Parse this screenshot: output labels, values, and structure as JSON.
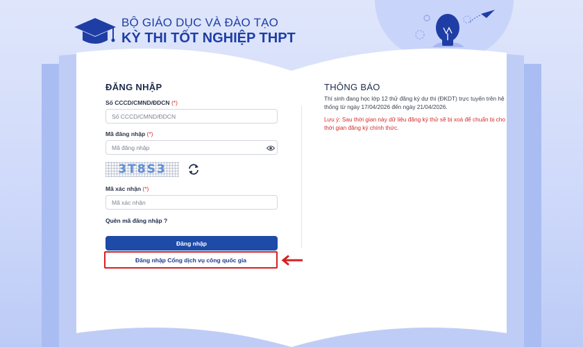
{
  "header": {
    "org": "BỘ GIÁO DỤC VÀ ĐÀO TẠO",
    "exam": "KỲ THI TỐT NGHIỆP THPT"
  },
  "login": {
    "title": "ĐĂNG NHẬP",
    "id_label": "Số CCCD/CMND/ĐDCN",
    "id_placeholder": "Số CCCD/CMND/ĐDCN",
    "password_label": "Mã đăng nhập",
    "password_placeholder": "Mã đăng nhập",
    "captcha_text": "3T8S3",
    "captcha_label": "Mã xác nhận",
    "captcha_placeholder": "Mã xác nhận",
    "required_mark": "(*)",
    "forgot": "Quên mã đăng nhập ?",
    "submit": "Đăng nhập",
    "gov_login": "Đăng nhập Cổng dịch vụ công quốc gia"
  },
  "notice": {
    "title": "THÔNG BÁO",
    "body": "Thí sinh đang học lớp 12 thử đăng ký dự thi (ĐKDT) trực tuyến trên hệ thống từ ngày 17/04/2026 đến ngày 21/04/2026.",
    "warning": "Lưu ý: Sau thời gian này dữ liệu đăng ký thử sẽ bị xoá để chuẩn bị cho thời gian đăng ký chính thức."
  },
  "icons": {
    "logo": "graduation-cap-icon",
    "bulb": "lightbulb-icon",
    "plane": "paper-plane-icon",
    "eye": "eye-icon",
    "refresh": "refresh-icon",
    "arrow": "arrow-left-icon"
  },
  "colors": {
    "brand": "#1f3ea5",
    "button": "#1e4ba8",
    "required": "#d62828",
    "highlight": "#d42020"
  }
}
